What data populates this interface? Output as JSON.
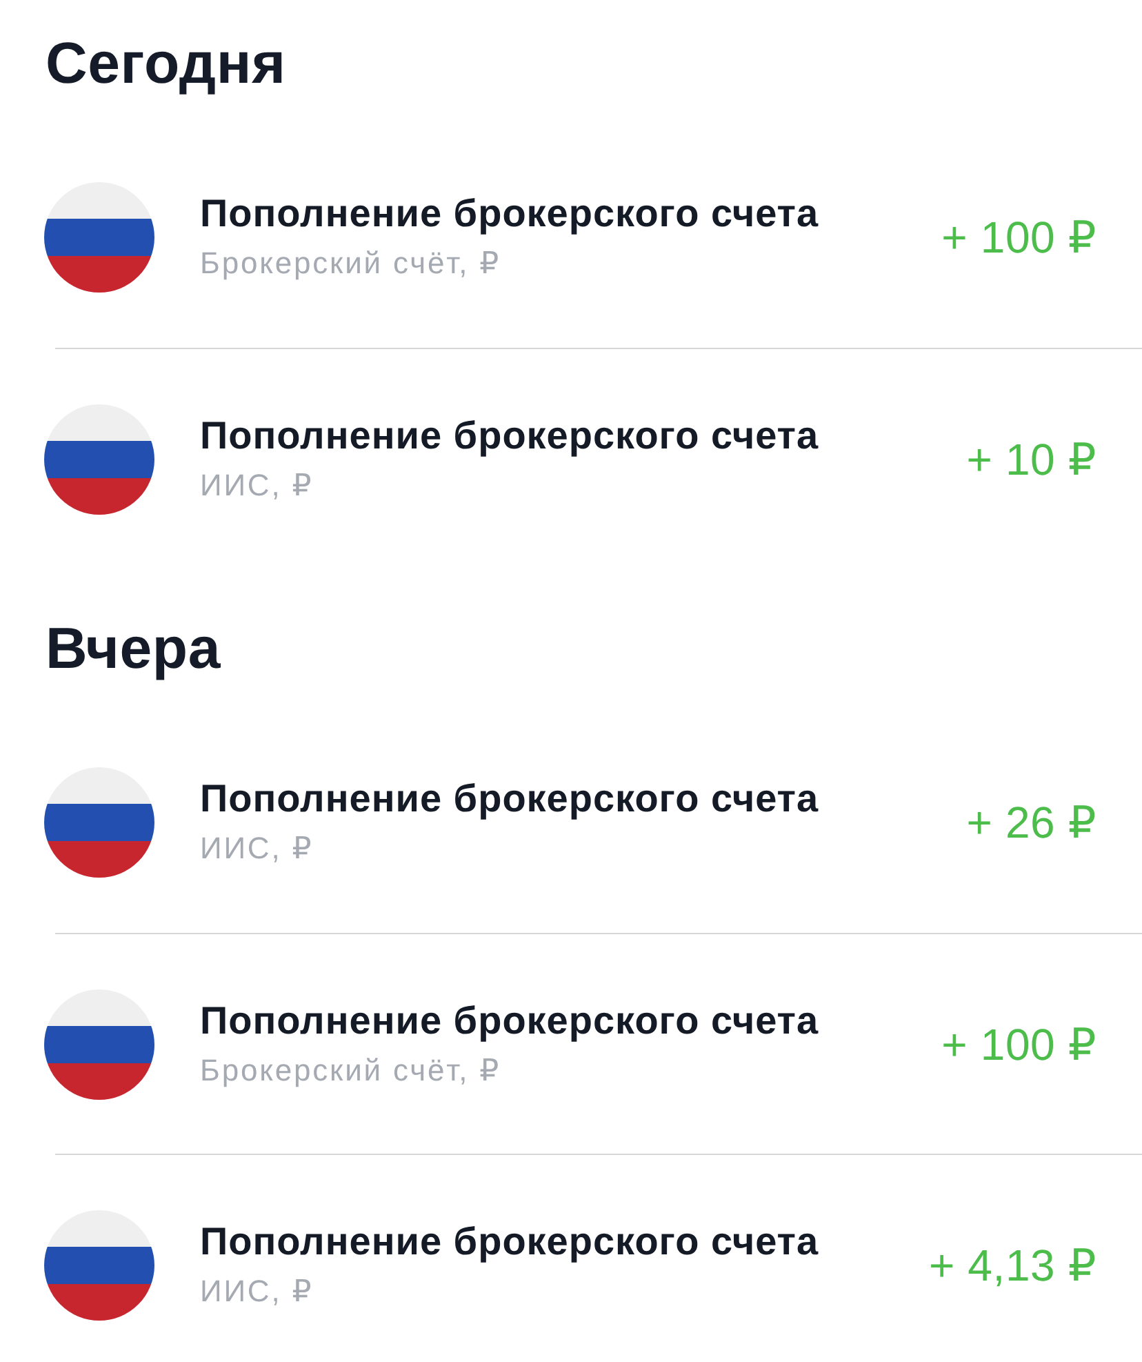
{
  "sections": [
    {
      "title": "Сегодня",
      "operations": [
        {
          "title": "Пополнение брокерского счета",
          "account": "Брокерский счёт, ₽",
          "amount": "+ 100 ₽"
        },
        {
          "title": "Пополнение брокерского счета",
          "account": "ИИС, ₽",
          "amount": "+ 10 ₽"
        }
      ]
    },
    {
      "title": "Вчера",
      "operations": [
        {
          "title": "Пополнение брокерского счета",
          "account": "ИИС, ₽",
          "amount": "+ 26 ₽"
        },
        {
          "title": "Пополнение брокерского счета",
          "account": "Брокерский счёт, ₽",
          "amount": "+ 100 ₽"
        },
        {
          "title": "Пополнение брокерского счета",
          "account": "ИИС, ₽",
          "amount": "+ 4,13 ₽"
        }
      ]
    }
  ]
}
